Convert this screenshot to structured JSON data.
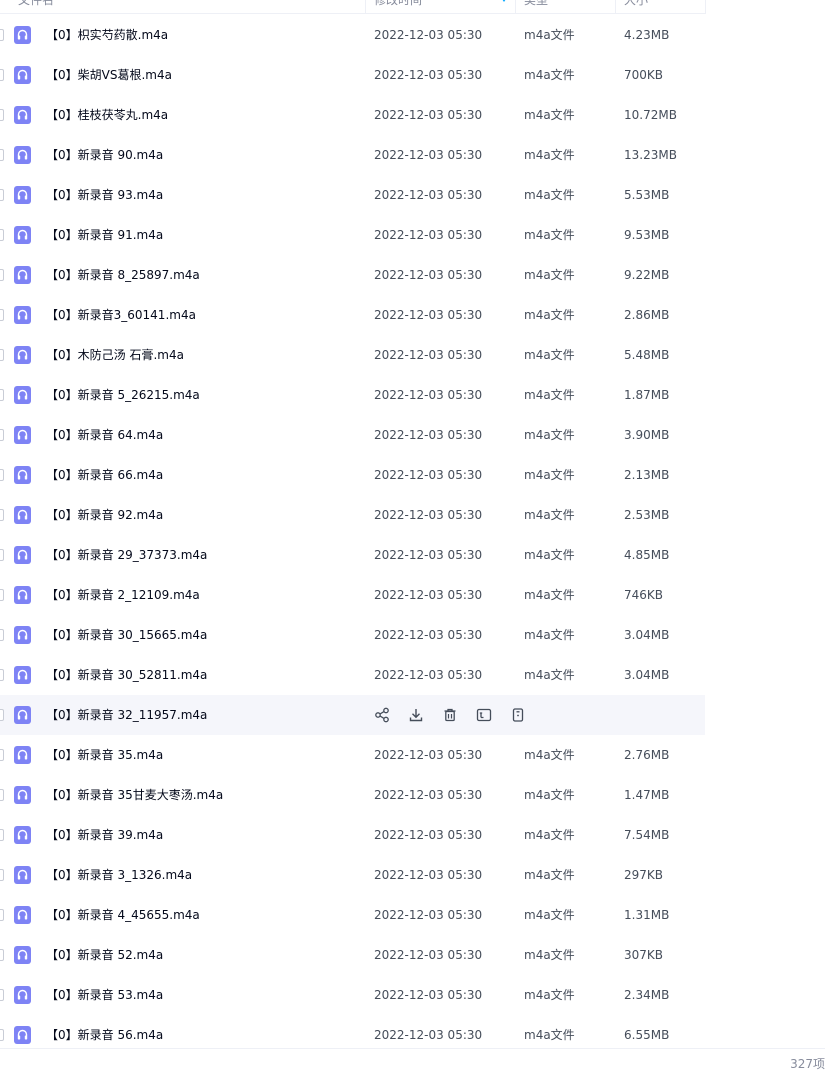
{
  "header": {
    "name_label": "文件名",
    "modified_label": "修改时间",
    "type_label": "类型",
    "size_label": "大小"
  },
  "files": [
    {
      "name": "【0】枳实芍药散.m4a",
      "date": "2022-12-03 05:30",
      "type": "m4a文件",
      "size": "4.23MB"
    },
    {
      "name": "【0】柴胡VS葛根.m4a",
      "date": "2022-12-03 05:30",
      "type": "m4a文件",
      "size": "700KB"
    },
    {
      "name": "【0】桂枝茯苓丸.m4a",
      "date": "2022-12-03 05:30",
      "type": "m4a文件",
      "size": "10.72MB"
    },
    {
      "name": "【0】新录音 90.m4a",
      "date": "2022-12-03 05:30",
      "type": "m4a文件",
      "size": "13.23MB"
    },
    {
      "name": "【0】新录音 93.m4a",
      "date": "2022-12-03 05:30",
      "type": "m4a文件",
      "size": "5.53MB"
    },
    {
      "name": "【0】新录音 91.m4a",
      "date": "2022-12-03 05:30",
      "type": "m4a文件",
      "size": "9.53MB"
    },
    {
      "name": "【0】新录音 8_25897.m4a",
      "date": "2022-12-03 05:30",
      "type": "m4a文件",
      "size": "9.22MB"
    },
    {
      "name": "【0】新录音3_60141.m4a",
      "date": "2022-12-03 05:30",
      "type": "m4a文件",
      "size": "2.86MB"
    },
    {
      "name": "【0】木防己汤 石膏.m4a",
      "date": "2022-12-03 05:30",
      "type": "m4a文件",
      "size": "5.48MB"
    },
    {
      "name": "【0】新录音 5_26215.m4a",
      "date": "2022-12-03 05:30",
      "type": "m4a文件",
      "size": "1.87MB"
    },
    {
      "name": "【0】新录音 64.m4a",
      "date": "2022-12-03 05:30",
      "type": "m4a文件",
      "size": "3.90MB"
    },
    {
      "name": "【0】新录音 66.m4a",
      "date": "2022-12-03 05:30",
      "type": "m4a文件",
      "size": "2.13MB"
    },
    {
      "name": "【0】新录音 92.m4a",
      "date": "2022-12-03 05:30",
      "type": "m4a文件",
      "size": "2.53MB"
    },
    {
      "name": "【0】新录音 29_37373.m4a",
      "date": "2022-12-03 05:30",
      "type": "m4a文件",
      "size": "4.85MB"
    },
    {
      "name": "【0】新录音 2_12109.m4a",
      "date": "2022-12-03 05:30",
      "type": "m4a文件",
      "size": "746KB"
    },
    {
      "name": "【0】新录音 30_15665.m4a",
      "date": "2022-12-03 05:30",
      "type": "m4a文件",
      "size": "3.04MB"
    },
    {
      "name": "【0】新录音 30_52811.m4a",
      "date": "2022-12-03 05:30",
      "type": "m4a文件",
      "size": "3.04MB"
    },
    {
      "name": "【0】新录音 32_11957.m4a",
      "date": "",
      "type": "",
      "size": "",
      "hover": true
    },
    {
      "name": "【0】新录音 35.m4a",
      "date": "2022-12-03 05:30",
      "type": "m4a文件",
      "size": "2.76MB"
    },
    {
      "name": "【0】新录音 35甘麦大枣汤.m4a",
      "date": "2022-12-03 05:30",
      "type": "m4a文件",
      "size": "1.47MB"
    },
    {
      "name": "【0】新录音 39.m4a",
      "date": "2022-12-03 05:30",
      "type": "m4a文件",
      "size": "7.54MB"
    },
    {
      "name": "【0】新录音 3_1326.m4a",
      "date": "2022-12-03 05:30",
      "type": "m4a文件",
      "size": "297KB"
    },
    {
      "name": "【0】新录音 4_45655.m4a",
      "date": "2022-12-03 05:30",
      "type": "m4a文件",
      "size": "1.31MB"
    },
    {
      "name": "【0】新录音 52.m4a",
      "date": "2022-12-03 05:30",
      "type": "m4a文件",
      "size": "307KB"
    },
    {
      "name": "【0】新录音 53.m4a",
      "date": "2022-12-03 05:30",
      "type": "m4a文件",
      "size": "2.34MB"
    },
    {
      "name": "【0】新录音 56.m4a",
      "date": "2022-12-03 05:30",
      "type": "m4a文件",
      "size": "6.55MB"
    }
  ],
  "row_actions": [
    "share-icon",
    "download-icon",
    "delete-icon",
    "rename-icon",
    "more-icon"
  ],
  "footer": {
    "count": "327项"
  },
  "colors": {
    "file_icon": "#7e83f5",
    "accent": "#06a7ff",
    "hover_row": "#f5f6fb"
  }
}
